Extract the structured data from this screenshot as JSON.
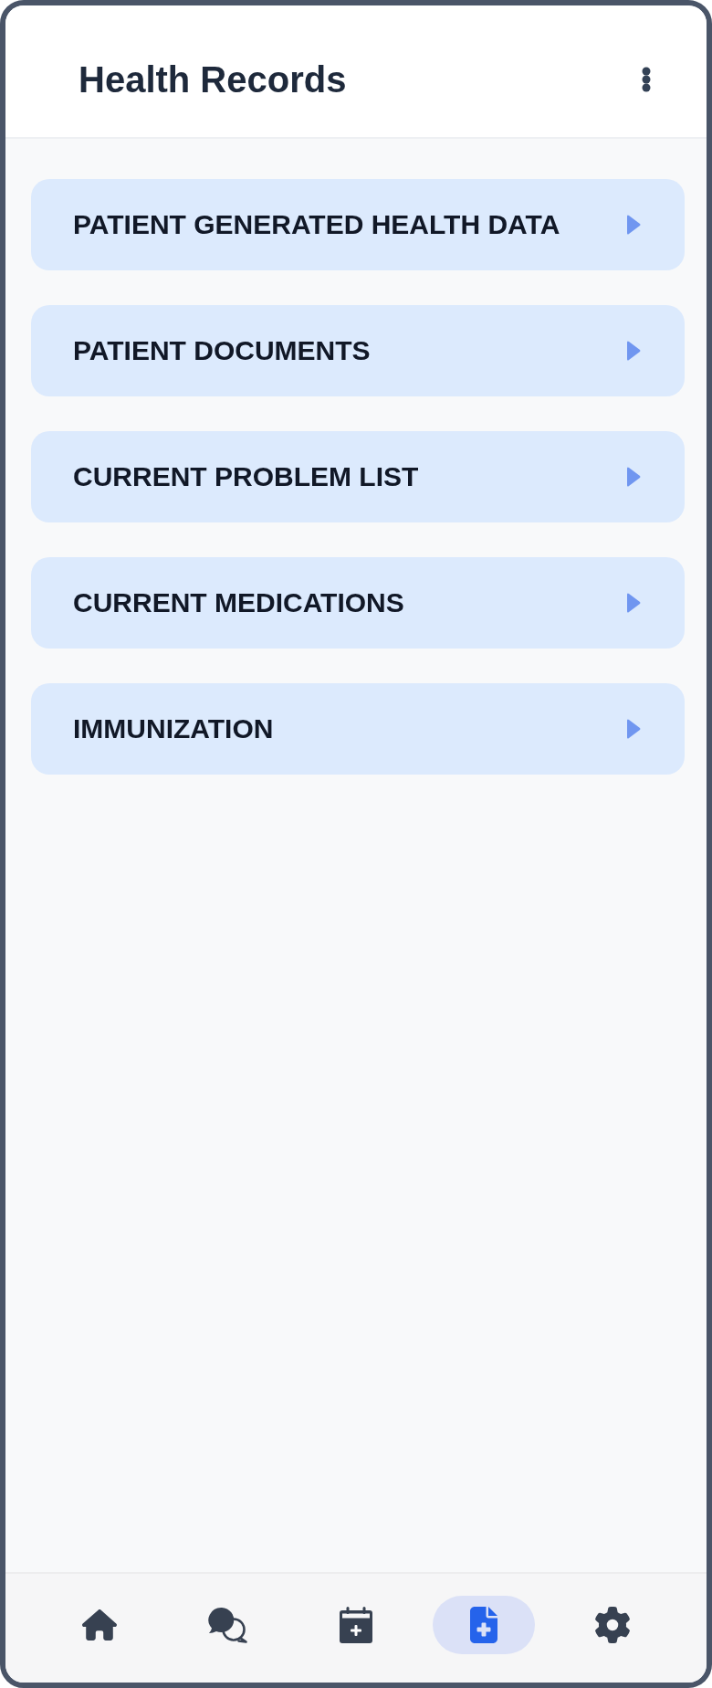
{
  "header": {
    "title": "Health Records"
  },
  "records": [
    {
      "label": "PATIENT GENERATED HEALTH DATA"
    },
    {
      "label": "PATIENT DOCUMENTS"
    },
    {
      "label": "CURRENT PROBLEM LIST"
    },
    {
      "label": "CURRENT MEDICATIONS"
    },
    {
      "label": "IMMUNIZATION"
    }
  ],
  "nav": [
    {
      "kind": "home",
      "selected": false
    },
    {
      "kind": "chat",
      "selected": false
    },
    {
      "kind": "calendar",
      "selected": false
    },
    {
      "kind": "records",
      "selected": true
    },
    {
      "kind": "settings",
      "selected": false
    }
  ]
}
